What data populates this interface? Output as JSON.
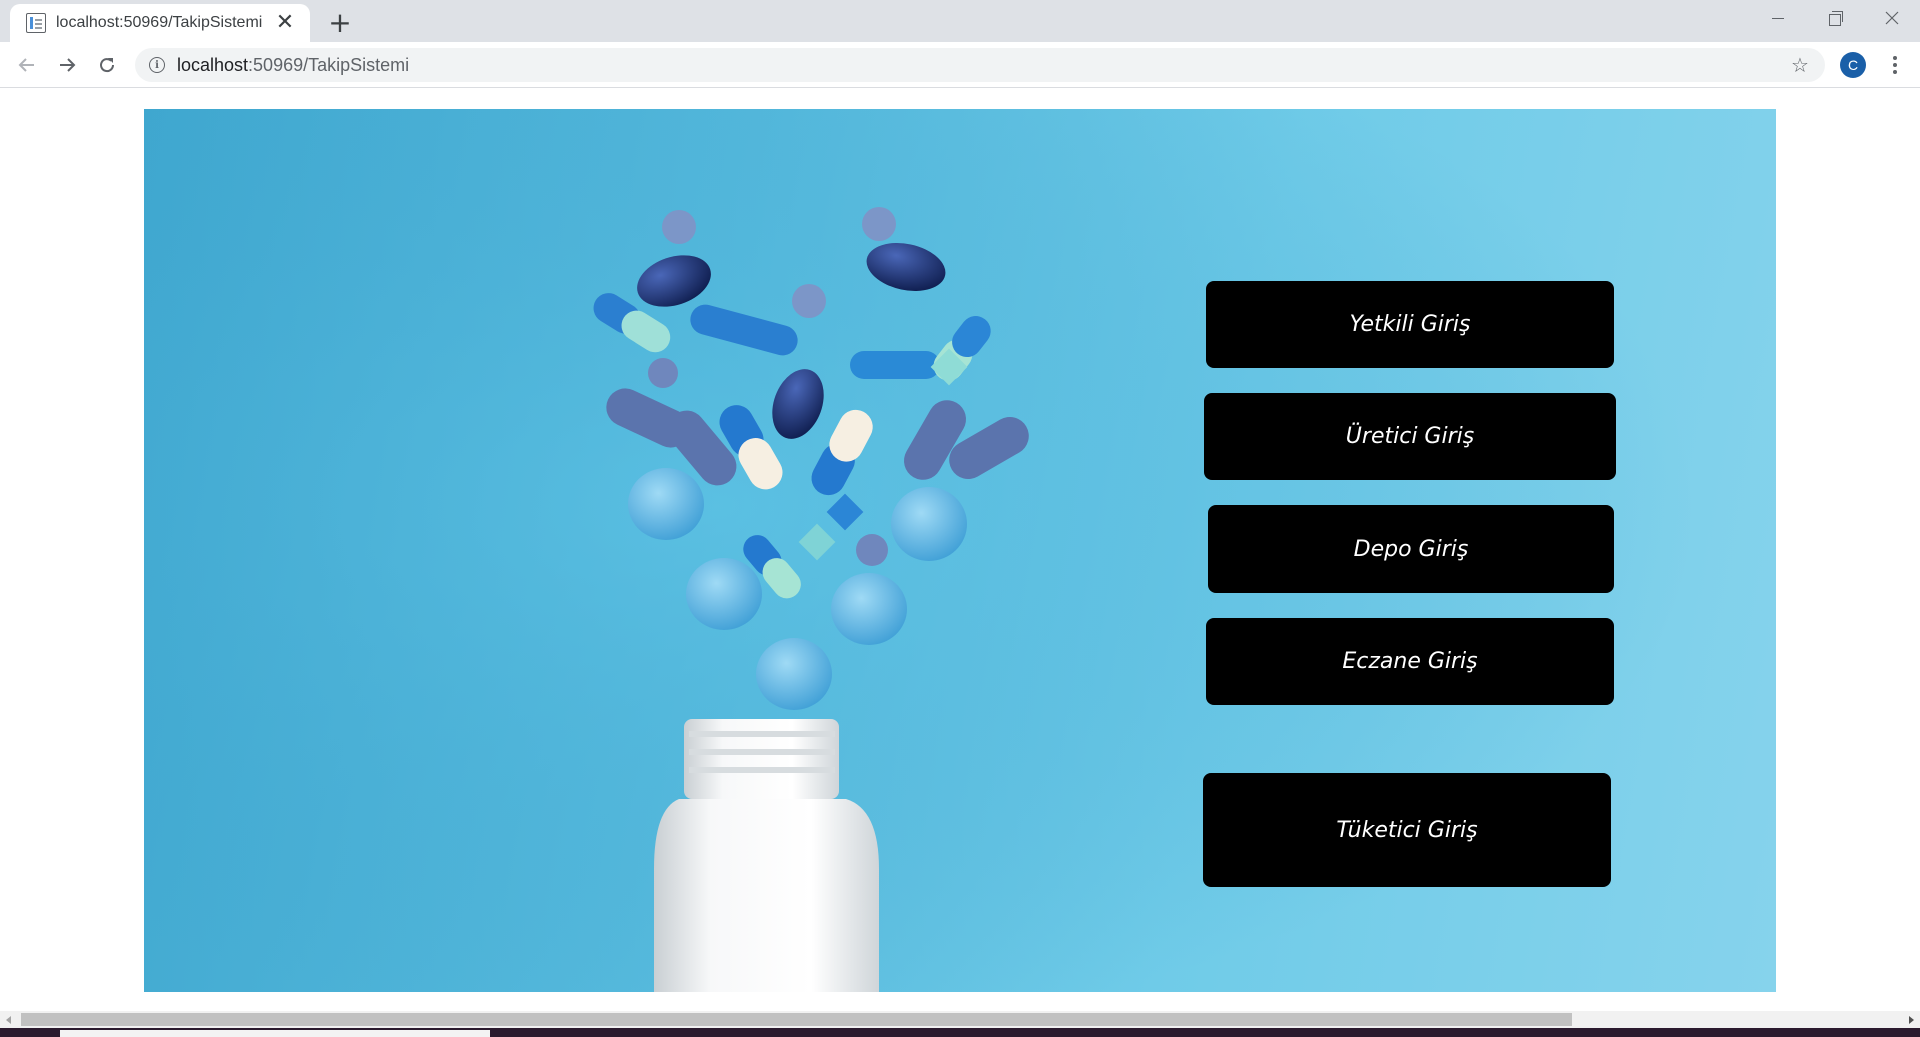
{
  "browser": {
    "tab_title": "localhost:50969/TakipSistemi",
    "tab_close_glyph": "✕",
    "new_tab_glyph": "+",
    "url_host": "localhost",
    "url_path": ":50969/TakipSistemi",
    "profile_initial": "C",
    "icons": [
      "page-favicon-icon",
      "close-icon",
      "plus-icon",
      "back-arrow-icon",
      "forward-arrow-icon",
      "reload-icon",
      "info-icon",
      "star-icon",
      "more-vert-icon"
    ]
  },
  "login_buttons": [
    {
      "label": "Yetkili Giriş"
    },
    {
      "label": "Üretici Giriş"
    },
    {
      "label": "Depo Giriş"
    },
    {
      "label": "Eczane Giriş"
    },
    {
      "label": "Tüketici Giriş"
    }
  ],
  "hero_image": {
    "subject": "pills-spilling-from-bottle",
    "background_color": "#5cc0e0"
  },
  "colors": {
    "button_bg": "#000000",
    "button_text": "#ffffff",
    "profile_avatar": "#1a5fa8"
  }
}
